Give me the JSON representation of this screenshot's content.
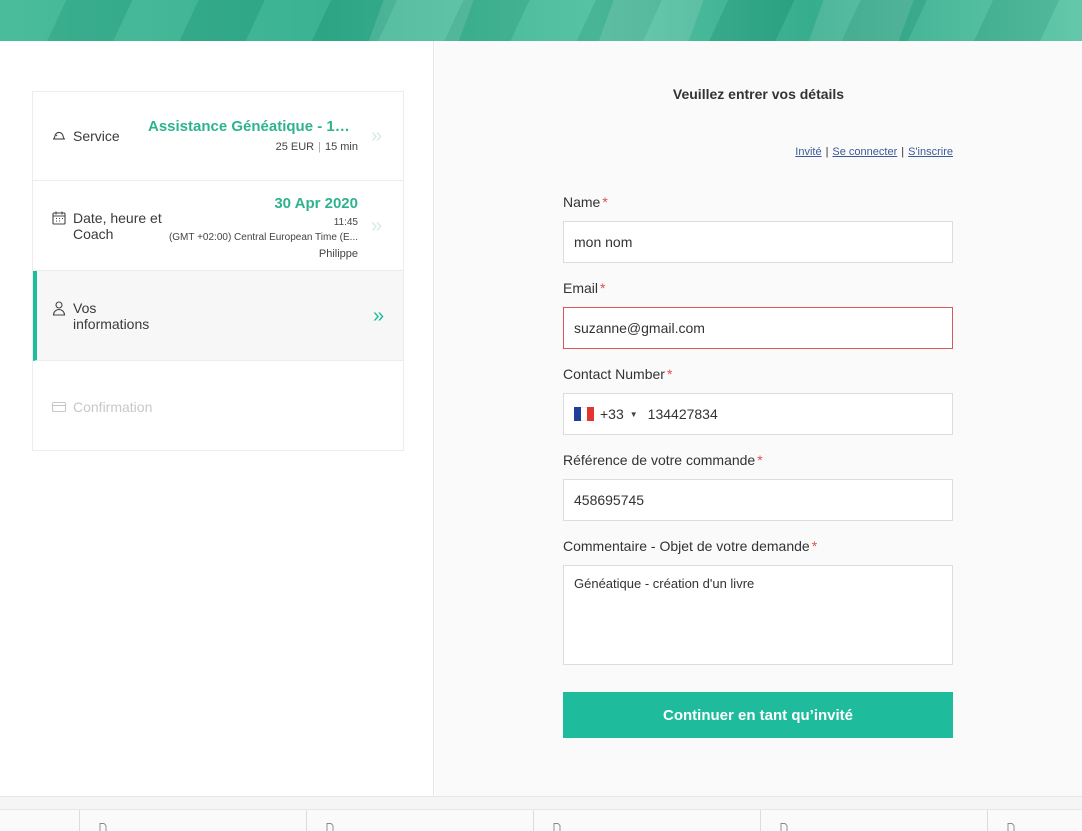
{
  "steps": [
    {
      "label": "Service"
    },
    {
      "label": "Date, heure et Coach"
    },
    {
      "label": "Vos informations"
    },
    {
      "label": "Confirmation"
    }
  ],
  "service": {
    "title": "Assistance Généatique - 15 ...",
    "price": "25 EUR",
    "duration": "15 min"
  },
  "appointment": {
    "date": "30 Apr 2020",
    "time": "11:45",
    "timezone": "(GMT +02:00) Central European Time (E...",
    "coach": "Philippe"
  },
  "form": {
    "title": "Veuillez entrer vos détails",
    "links": {
      "guest": "Invité",
      "login": "Se connecter",
      "signup": "S'inscrire",
      "sep": "|"
    },
    "required_mark": "*",
    "name": {
      "label": "Name",
      "value": "mon nom"
    },
    "email": {
      "label": "Email",
      "value": "suzanne@gmail.com"
    },
    "phone": {
      "label": "Contact Number",
      "dial_code": "+33",
      "value": "134427834"
    },
    "reference": {
      "label": "Référence de votre commande",
      "value": "458695745"
    },
    "comment": {
      "label": "Commentaire - Objet de votre demande",
      "value": "Généatique - création d'un livre"
    },
    "submit_label": "Continuer en tant qu’invité"
  },
  "colors": {
    "accent": "#1ebc9c",
    "error": "#d9595b"
  }
}
